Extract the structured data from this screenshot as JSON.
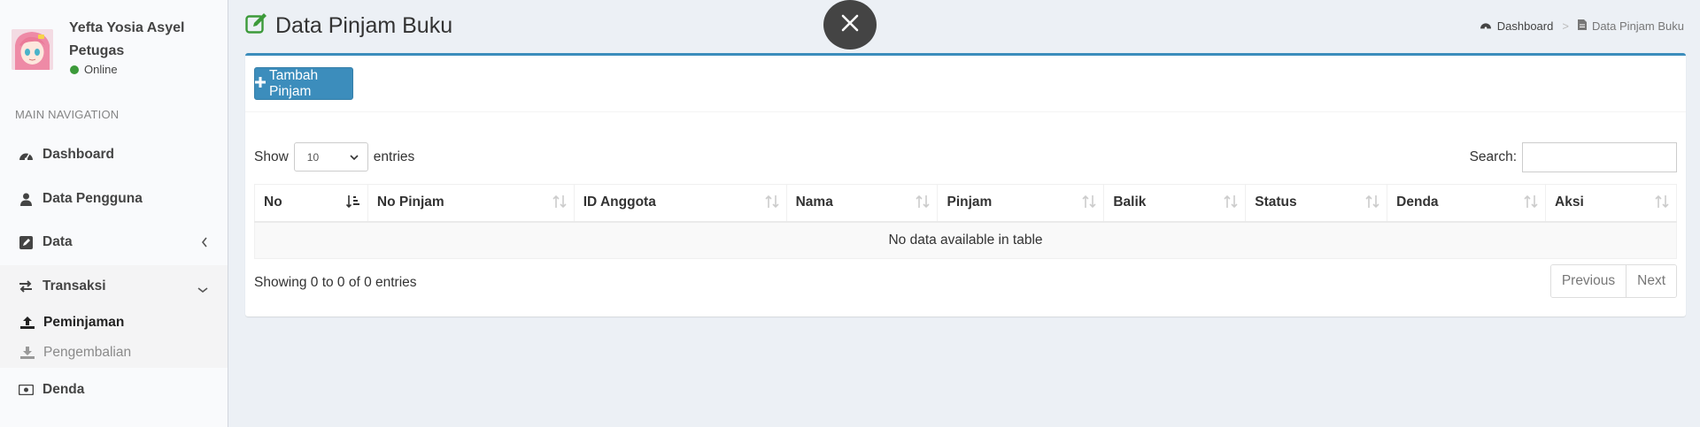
{
  "user": {
    "name": "Yefta Yosia Asyel Petugas",
    "status": "Online"
  },
  "nav": {
    "header": "MAIN NAVIGATION",
    "items": [
      {
        "label": "Dashboard",
        "icon": "dashboard-icon"
      },
      {
        "label": "Data Pengguna",
        "icon": "user-icon"
      },
      {
        "label": "Data",
        "icon": "edit-icon"
      },
      {
        "label": "Transaksi",
        "icon": "exchange-icon"
      },
      {
        "label": "Denda",
        "icon": "money-icon"
      }
    ],
    "sub": [
      {
        "label": "Peminjaman",
        "icon": "upload-icon"
      },
      {
        "label": "Pengembalian",
        "icon": "download-icon"
      }
    ]
  },
  "page": {
    "title": "Data Pinjam Buku"
  },
  "breadcrumb": {
    "home": "Dashboard",
    "separator": ">",
    "current": "Data Pinjam Buku"
  },
  "toolbar": {
    "add_label": "Tambah Pinjam"
  },
  "table": {
    "show_label": "Show",
    "page_size": "10",
    "entries_label": "entries",
    "search_label": "Search:",
    "search_value": "",
    "columns": [
      "No",
      "No Pinjam",
      "ID Anggota",
      "Nama",
      "Pinjam",
      "Balik",
      "Status",
      "Denda",
      "Aksi"
    ],
    "empty_text": "No data available in table",
    "info": "Showing 0 to 0 of 0 entries",
    "prev": "Previous",
    "next": "Next"
  },
  "colors": {
    "primary": "#3c8dbc",
    "online": "#3c9a3a",
    "close_bg": "#444444",
    "title_icon": "#3c9a3a"
  }
}
